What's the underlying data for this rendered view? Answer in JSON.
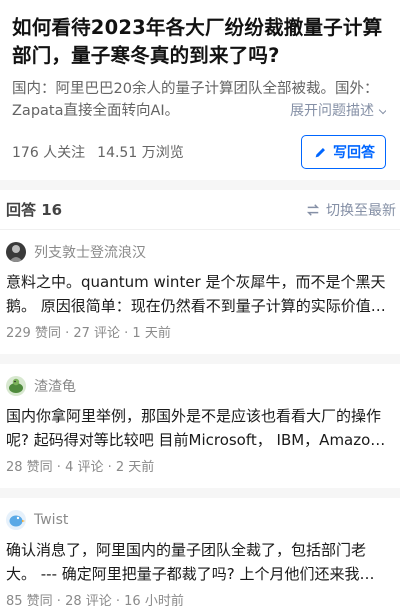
{
  "question": {
    "title": "如何看待2023年各大厂纷纷裁撤量子计算部门，量子寒冬真的到来了吗?",
    "description": "国内：阿里巴巴20余人的量子计算团队全部被裁。国外：Zapata直接全面转向AI。",
    "expand_label": "展开问题描述",
    "followers": "176 人关注",
    "views": "14.51 万浏览",
    "write_answer_label": "写回答"
  },
  "answers_header": {
    "count_label": "回答 16",
    "sort_label": "切换至最新"
  },
  "answers": [
    {
      "author": "列支敦士登流浪汉",
      "excerpt": "意料之中。quantum winter 是个灰犀牛，而不是个黑天鹅。 原因很简单：现在仍然看不到量子计算的实际价值…",
      "meta": "229 赞同 · 27 评论 · 1 天前",
      "avatar": "bw-figure"
    },
    {
      "author": "渣渣龟",
      "excerpt": "国内你拿阿里举例，那国外是不是应该也看看大厂的操作呢? 起码得对等比较吧 目前Microsoft， IBM，Amazo…",
      "meta": "28 赞同 · 4 评论 · 2 天前",
      "avatar": "green-turtle"
    },
    {
      "author": "Twist",
      "excerpt": "确认消息了，阿里国内的量子团队全裁了，包括部门老大。 --- 确定阿里把量子都裁了吗? 上个月他们还来我…",
      "meta": "85 赞同 · 28 评论 · 16 小时前",
      "avatar": "blue-bird"
    }
  ],
  "colors": {
    "accent": "#0066ff",
    "muted": "#8590a6",
    "text": "#121212"
  }
}
